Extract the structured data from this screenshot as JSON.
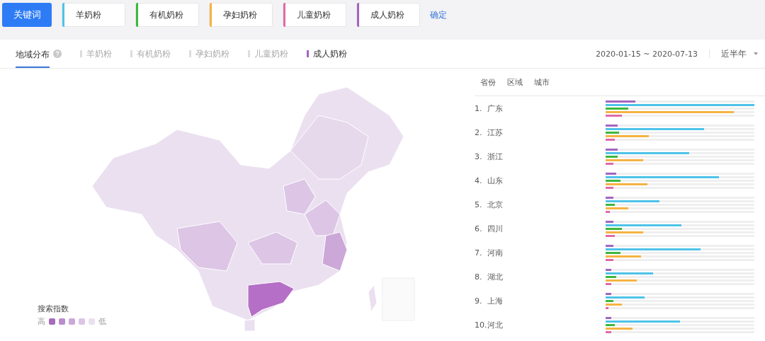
{
  "keyword_bar": {
    "label": "关键词",
    "keywords": [
      {
        "text": "羊奶粉",
        "color": "#4ec3e8"
      },
      {
        "text": "有机奶粉",
        "color": "#3cb83c"
      },
      {
        "text": "孕妇奶粉",
        "color": "#f5b342"
      },
      {
        "text": "儿童奶粉",
        "color": "#e06aaa"
      },
      {
        "text": "成人奶粉",
        "color": "#a565c0"
      }
    ],
    "confirm": "确定"
  },
  "section_title": "地域分布",
  "tabs": [
    {
      "label": "羊奶粉",
      "selected": false
    },
    {
      "label": "有机奶粉",
      "selected": false
    },
    {
      "label": "孕妇奶粉",
      "selected": false
    },
    {
      "label": "儿童奶粉",
      "selected": false
    },
    {
      "label": "成人奶粉",
      "selected": true
    }
  ],
  "date_range": "2020-01-15 ~ 2020-07-13",
  "period": "近半年",
  "legend": {
    "title": "搜索指数",
    "high": "高",
    "low": "低",
    "swatches": [
      {
        "color": "#a66cba"
      },
      {
        "color": "#b98dcb"
      },
      {
        "color": "#cba8d8"
      },
      {
        "color": "#dcc5e5"
      },
      {
        "color": "#ebe0f0"
      }
    ]
  },
  "region_tabs": [
    "省份",
    "区域",
    "城市"
  ],
  "rows": [
    {
      "rank": "1.",
      "name": "广东",
      "bars": [
        {
          "color": "#a565c0",
          "level": 0.2
        },
        {
          "color": "#4ec3e8",
          "level": 1.0
        },
        {
          "color": "#3cb83c",
          "level": 0.15
        },
        {
          "color": "#f5b342",
          "level": 0.86
        },
        {
          "color": "#e06aaa",
          "level": 0.11
        }
      ]
    },
    {
      "rank": "2.",
      "name": "江苏",
      "bars": [
        {
          "color": "#a565c0",
          "level": 0.08
        },
        {
          "color": "#4ec3e8",
          "level": 0.66
        },
        {
          "color": "#3cb83c",
          "level": 0.09
        },
        {
          "color": "#f5b342",
          "level": 0.29
        },
        {
          "color": "#e06aaa",
          "level": 0.06
        }
      ]
    },
    {
      "rank": "3.",
      "name": "浙江",
      "bars": [
        {
          "color": "#a565c0",
          "level": 0.08
        },
        {
          "color": "#4ec3e8",
          "level": 0.56
        },
        {
          "color": "#3cb83c",
          "level": 0.08
        },
        {
          "color": "#f5b342",
          "level": 0.25
        },
        {
          "color": "#e06aaa",
          "level": 0.05
        }
      ]
    },
    {
      "rank": "4.",
      "name": "山东",
      "bars": [
        {
          "color": "#a565c0",
          "level": 0.07
        },
        {
          "color": "#4ec3e8",
          "level": 0.76
        },
        {
          "color": "#3cb83c",
          "level": 0.1
        },
        {
          "color": "#f5b342",
          "level": 0.28
        },
        {
          "color": "#e06aaa",
          "level": 0.05
        }
      ]
    },
    {
      "rank": "5.",
      "name": "北京",
      "bars": [
        {
          "color": "#a565c0",
          "level": 0.05
        },
        {
          "color": "#4ec3e8",
          "level": 0.36
        },
        {
          "color": "#3cb83c",
          "level": 0.06
        },
        {
          "color": "#f5b342",
          "level": 0.15
        },
        {
          "color": "#e06aaa",
          "level": 0.03
        }
      ]
    },
    {
      "rank": "6.",
      "name": "四川",
      "bars": [
        {
          "color": "#a565c0",
          "level": 0.05
        },
        {
          "color": "#4ec3e8",
          "level": 0.51
        },
        {
          "color": "#3cb83c",
          "level": 0.11
        },
        {
          "color": "#f5b342",
          "level": 0.25
        },
        {
          "color": "#e06aaa",
          "level": 0.06
        }
      ]
    },
    {
      "rank": "7.",
      "name": "河南",
      "bars": [
        {
          "color": "#a565c0",
          "level": 0.05
        },
        {
          "color": "#4ec3e8",
          "level": 0.64
        },
        {
          "color": "#3cb83c",
          "level": 0.1
        },
        {
          "color": "#f5b342",
          "level": 0.24
        },
        {
          "color": "#e06aaa",
          "level": 0.05
        }
      ]
    },
    {
      "rank": "8.",
      "name": "湖北",
      "bars": [
        {
          "color": "#a565c0",
          "level": 0.04
        },
        {
          "color": "#4ec3e8",
          "level": 0.32
        },
        {
          "color": "#3cb83c",
          "level": 0.07
        },
        {
          "color": "#f5b342",
          "level": 0.21
        },
        {
          "color": "#e06aaa",
          "level": 0.04
        }
      ]
    },
    {
      "rank": "9.",
      "name": "上海",
      "bars": [
        {
          "color": "#a565c0",
          "level": 0.04
        },
        {
          "color": "#4ec3e8",
          "level": 0.26
        },
        {
          "color": "#3cb83c",
          "level": 0.05
        },
        {
          "color": "#f5b342",
          "level": 0.11
        },
        {
          "color": "#e06aaa",
          "level": 0.02
        }
      ]
    },
    {
      "rank": "10.",
      "name": "河北",
      "bars": [
        {
          "color": "#a565c0",
          "level": 0.04
        },
        {
          "color": "#4ec3e8",
          "level": 0.5
        },
        {
          "color": "#3cb83c",
          "level": 0.06
        },
        {
          "color": "#f5b342",
          "level": 0.18
        },
        {
          "color": "#e06aaa",
          "level": 0.04
        }
      ]
    }
  ]
}
